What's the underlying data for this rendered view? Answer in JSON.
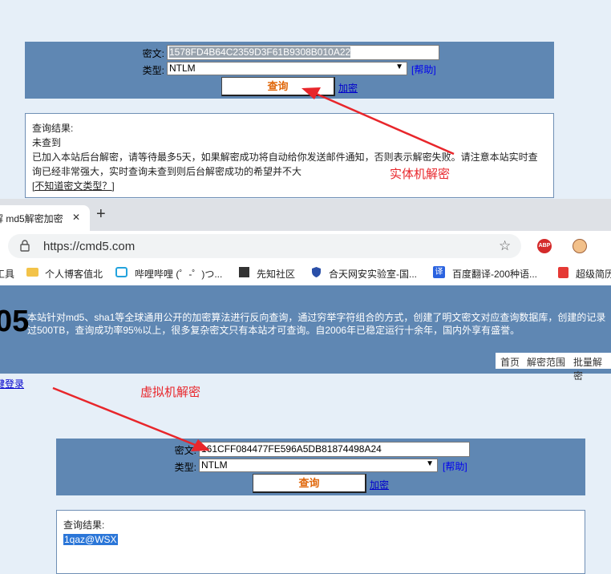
{
  "top": {
    "cipher_label": "密文:",
    "cipher_value": "1578FD4B64C2359D3F61B9308B010A22",
    "type_label": "类型:",
    "type_value": "NTLM",
    "help_label": "[帮助]",
    "query_label": "查询",
    "encrypt_label": "加密",
    "result_title": "查询结果:",
    "result_status": "未查到",
    "result_msg1": "已加入本站后台解密，请等待最多5天，如果解密成功将自动给你发送邮件通知，否则表示解密失败。请注意本站实时查",
    "result_msg2": "询已经非常强大，实时查询未查到则后台解密成功的希望并不大",
    "result_link": "[不知道密文类型？]",
    "annotation": "实体机解密"
  },
  "browser": {
    "tab_title": "解 md5解密加密",
    "tab_close": "✕",
    "new_tab": "+",
    "url": "https://cmd5.com",
    "bookmarks": [
      {
        "label": "工具"
      },
      {
        "label": "个人博客值北"
      },
      {
        "label": "哔哩哔哩 (゜-゜)つ..."
      },
      {
        "label": "先知社区"
      },
      {
        "label": "合天网安实验室-国..."
      },
      {
        "label": "百度翻译-200种语..."
      },
      {
        "label": "超级简历"
      }
    ],
    "abp_label": "ABP"
  },
  "site": {
    "logo_partial": "05",
    "desc_line1": "本站针对md5、sha1等全球通用公开的加密算法进行反向查询，通过穷举字符组合的方式，创建了明文密文对应查询数据库，创建的记录",
    "desc_line2": "过500TB，查询成功率95%以上，很多复杂密文只有本站才可查询。自2006年已稳定运行十余年，国内外享有盛誉。",
    "nav": [
      "首页",
      "解密范围",
      "批量解密"
    ],
    "login_link": "键登录",
    "annotation": "虚拟机解密"
  },
  "bottom": {
    "cipher_label": "密文:",
    "cipher_value": "161CFF084477FE596A5DB81874498A24",
    "type_label": "类型:",
    "type_value": "NTLM",
    "help_label": "[帮助]",
    "query_label": "查询",
    "encrypt_label": "加密",
    "result_title": "查询结果:",
    "result_value": "1qaz@WSX"
  },
  "colors": {
    "form_bg": "#5f87b3",
    "page_bg": "#e6eff8",
    "accent_orange": "#e0680c",
    "annotation_red": "#e8262b"
  }
}
